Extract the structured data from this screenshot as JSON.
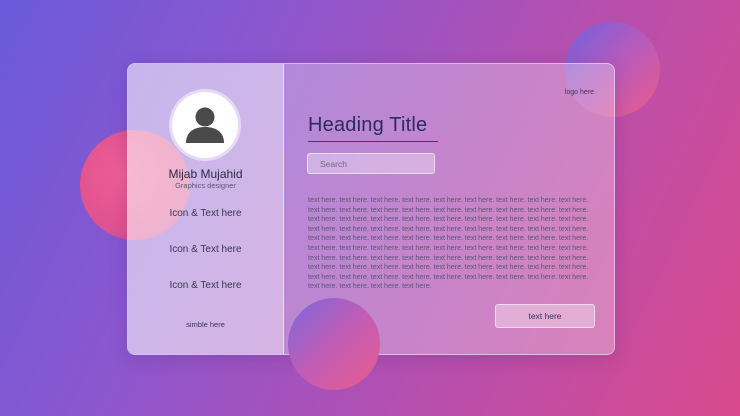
{
  "profile": {
    "name": "Mijab Mujahid",
    "role": "Graphics designer"
  },
  "nav": {
    "items": [
      {
        "label": "Icon & Text here"
      },
      {
        "label": "Icon & Text here"
      },
      {
        "label": "Icon & Text here"
      }
    ],
    "footer": "simble here"
  },
  "header": {
    "logo": "logo here",
    "title": "Heading Title"
  },
  "search": {
    "placeholder": "Search",
    "value": ""
  },
  "content": {
    "body": "text here. text here. text here. text here. text here. text here. text here. text here. text here. text here. text here. text here. text here. text here. text here. text here. text here. text here. text here. text here. text here. text here. text here. text here. text here. text here. text here. text here. text here. text here. text here. text here. text here. text here. text here. text here. text here. text here. text here. text here. text here. text here. text here. text here. text here. text here. text here. text here. text here. text here. text here. text here. text here. text here. text here. text here. text here. text here. text here. text here. text here. text here. text here. text here. text here. text here. text here. text here. text here. text here. text here. text here. text here. text here. text here. text here. text here. text here. text here. text here. text here. text here. text here. text here. text here.",
    "button_label": "text here"
  },
  "colors": {
    "heading": "#2e2a5c",
    "accent_pink": "#e2548f",
    "accent_purple": "#6a5ad9"
  }
}
